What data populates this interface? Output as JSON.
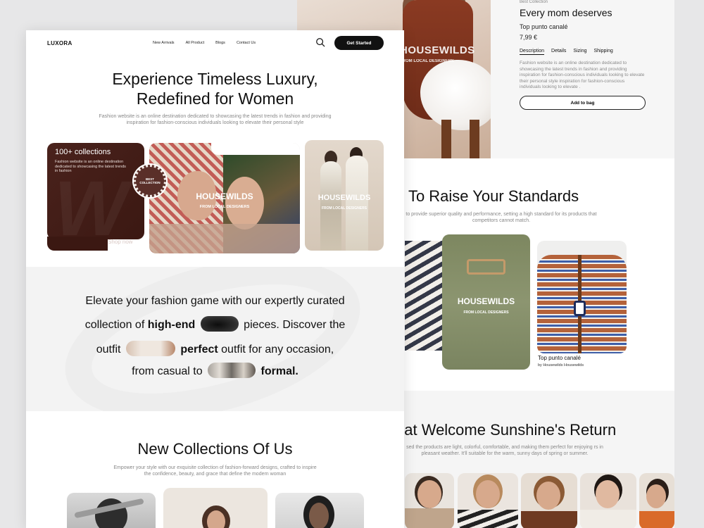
{
  "back_page": {
    "hero_watermark": "HOUSEWILDS",
    "hero_watermark_sub": "FROM LOCAL DESIGNERS",
    "eyebrow": "Best Collection",
    "title": "Every mom deserves",
    "product_name": "Top punto canalé",
    "price": "7,99 €",
    "tabs": [
      {
        "label": "Description"
      },
      {
        "label": "Details"
      },
      {
        "label": "Sizing"
      },
      {
        "label": "Shipping"
      }
    ],
    "description": "Fashion website is an online destination dedicated to showcasing the latest trends in fashion and providing inspiration for fashion-conscious individuals looking to elevate their personal style inspiration for fashion-conscious individuals looking to elevate .",
    "add_to_bag": "Add to bag",
    "standards_heading": "e To Raise Your Standards",
    "standards_text": "to provide superior quality and performance, setting a high standard for its products that competitors cannot match.",
    "product_card": {
      "watermark": "HOUSEWILDS",
      "watermark_sub": "FROM LOCAL DESIGNERS"
    },
    "featured_product": {
      "name": "Top punto canalé",
      "by": "by Housewilds Housewilds"
    },
    "sunshine_heading": "hat Welcome Sunshine's Return",
    "sunshine_text": "sed the products are light, colorful, comfortable, and making them perfect for enjoying rs in pleasant weather. It'll suitable for the warm, sunny days of spring or summer."
  },
  "front_page": {
    "logo": "LUXORA",
    "nav": [
      {
        "label": "New Arrivals"
      },
      {
        "label": "All Product"
      },
      {
        "label": "Blogs"
      },
      {
        "label": "Contact Us"
      }
    ],
    "cta": "Get Started",
    "hero_title_line1": "Experience Timeless Luxury,",
    "hero_title_line2": "Redefined for Women",
    "hero_text": "Fashion website is an online destination dedicated to showcasing the latest trends in fashion and providing inspiration for fashion-conscious individuals looking to elevate their personal style",
    "collections_card": {
      "title": "100+ collections",
      "text": "Fashion website is an online destination dedicated to showcasing the latest trends in fashion",
      "shop_now": "Shop now"
    },
    "badge": {
      "line1": "BEST",
      "line2": "COLLECTION"
    },
    "mid_card": {
      "watermark": "HOUSEWILDS",
      "sub": "FROM LOCAL DESIGNERS"
    },
    "right_card": {
      "watermark": "HOUSEWILDS",
      "sub": "FROM LOCAL DESIGNERS"
    },
    "statement": {
      "l1": "Elevate your fashion game with our expertly curated",
      "l2a": "collection of",
      "l2b": "high-end",
      "l2c": "pieces. Discover the",
      "l3a": "outfit",
      "l3b": "perfect",
      "l3c": "outfit for any occasion,",
      "l4a": "from casual to",
      "l4b": "formal."
    },
    "collections_heading": "New Collections Of Us",
    "collections_text": "Empower your style with our exquisite collection of fashion-forward designs, crafted to inspire the confidence, beauty, and grace that define the modern woman"
  },
  "colors": {
    "page_bg": "#e7e7e8",
    "dark_card": "#3b1812",
    "cta_bg": "#111111",
    "band_bg": "#f3f3f3"
  },
  "icons": [
    "search-icon"
  ]
}
